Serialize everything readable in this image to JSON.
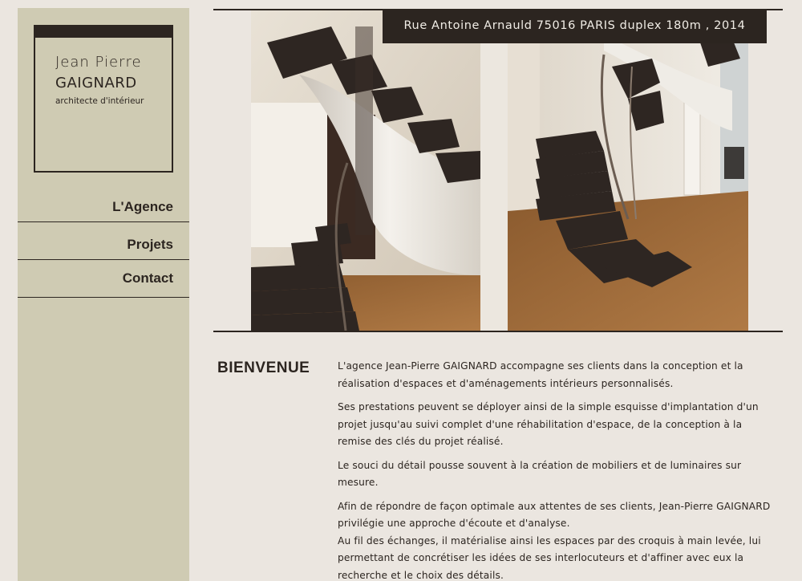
{
  "logo": {
    "line1": "Jean Pierre",
    "line2": "GAIGNARD",
    "line3": "architecte d'intérieur"
  },
  "nav": {
    "items": [
      {
        "label": "L'Agence"
      },
      {
        "label": "Projets"
      },
      {
        "label": "Contact"
      }
    ]
  },
  "hero": {
    "caption": "Rue Antoine Arnauld 75016 PARIS duplex 180m , 2014"
  },
  "main": {
    "heading": "BIENVENUE",
    "paragraphs": [
      "L'agence Jean-Pierre GAIGNARD accompagne ses clients dans la conception et la réalisation d'espaces et d'aménagements intérieurs personnalisés.",
      "Ses prestations peuvent se déployer ainsi de la simple esquisse d'implantation d'un projet jusqu'au suivi complet d'une réhabilitation d'espace, de la conception à la remise des clés du projet réalisé.",
      "Le souci du détail pousse souvent à la création de mobiliers et de luminaires sur mesure.",
      "Afin de répondre de façon optimale aux attentes de ses clients, Jean-Pierre GAIGNARD privilégie une approche d'écoute et d'analyse.",
      "Au fil des échanges, il matérialise ainsi les espaces par des croquis à main levée, lui permettant de concrétiser les idées de ses interlocuteurs et d'affiner avec eux la recherche et le choix des détails."
    ]
  },
  "colors": {
    "sidebar": "#cfcbb3",
    "page": "#ebe6e0",
    "dark": "#2c2520"
  }
}
